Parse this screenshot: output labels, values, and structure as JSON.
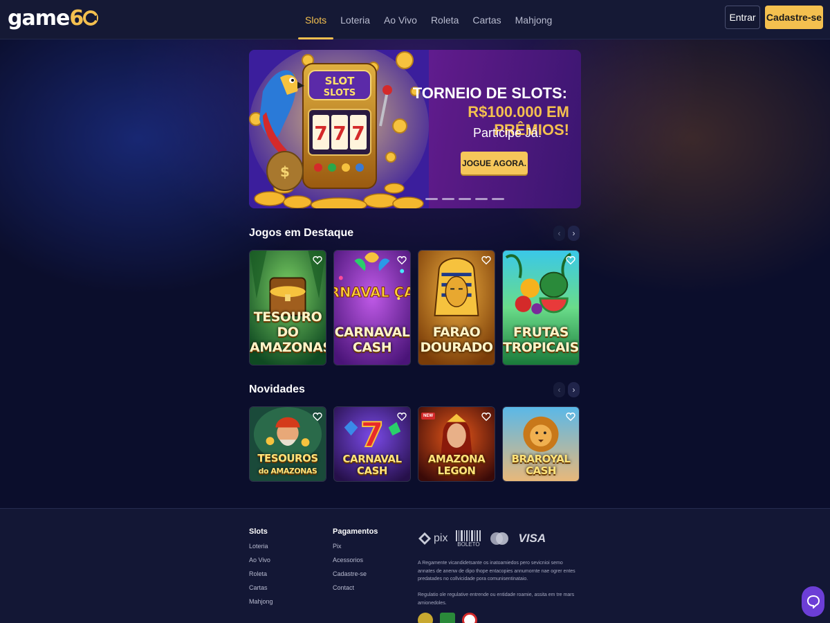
{
  "header": {
    "logo_text": "game",
    "logo_accent": "6",
    "nav": [
      "Slots",
      "Loteria",
      "Ao Vivo",
      "Roleta",
      "Cartas",
      "Mahjong"
    ],
    "active_nav": "Slots",
    "login_label": "Entrar",
    "signup_label": "Cadastre-se"
  },
  "banner": {
    "art_text": "SLOT SLOTS",
    "reels": "777",
    "title": "TORNEIO DE SLOTS:",
    "prize": "R$100.000 EM PRÊMIOS!",
    "subtitle": "Participe Já.",
    "cta_label": "JOGUE AGORA."
  },
  "featured": {
    "title": "Jogos em Destaque",
    "games": [
      {
        "line1": "TESOURO DO",
        "line2": "AMAZONAS"
      },
      {
        "line1": "CARNAVAL",
        "line2": "CASH",
        "art_text": "CARNAVAL CASH"
      },
      {
        "line1": "FARAO",
        "line2": "DOURADO"
      },
      {
        "line1": "FRUTAS",
        "line2": "TROPICAIS"
      }
    ]
  },
  "new_games": {
    "title": "Novidades",
    "games": [
      {
        "line1": "TESOUROS",
        "line2": "do AMAZONAS"
      },
      {
        "line1": "CARNAVAL",
        "line2": "CASH"
      },
      {
        "line1": "AMAZONA",
        "line2": "LEGON",
        "badge": "NEW"
      },
      {
        "line1": "BRAROYAL",
        "line2": "CASH"
      }
    ]
  },
  "footer": {
    "col1": {
      "title": "Slots",
      "links": [
        "Loteria",
        "Ao Vivo",
        "Roleta",
        "Cartas",
        "Mahjong"
      ]
    },
    "col2": {
      "title": "Pagamentos",
      "links": [
        "Pix",
        "Acessorios",
        "Cadastre-se",
        "Contact"
      ]
    },
    "payments": [
      "pix",
      "BOLETO",
      "mastercard",
      "VISA"
    ],
    "legal_text": "A Regamente vicandidetsante os inatoamiedos pero sevicnioi semo annates de anenw de dipo thope entacopies annumornte nae ogrer entes predatades no collvicidade pora comunisentinataio.",
    "legal_text2": "Regulatio ole regulative entrende ou entidade roamie, assita em tre mars amionedoles."
  },
  "colors": {
    "accent": "#f4c04f",
    "background": "#0b0e2c",
    "header": "#151935",
    "chat": "#6c3ed6"
  },
  "icons": [
    "heart-icon",
    "chevron-left-icon",
    "chevron-right-icon",
    "chat-icon",
    "pix-icon",
    "mastercard-icon"
  ]
}
